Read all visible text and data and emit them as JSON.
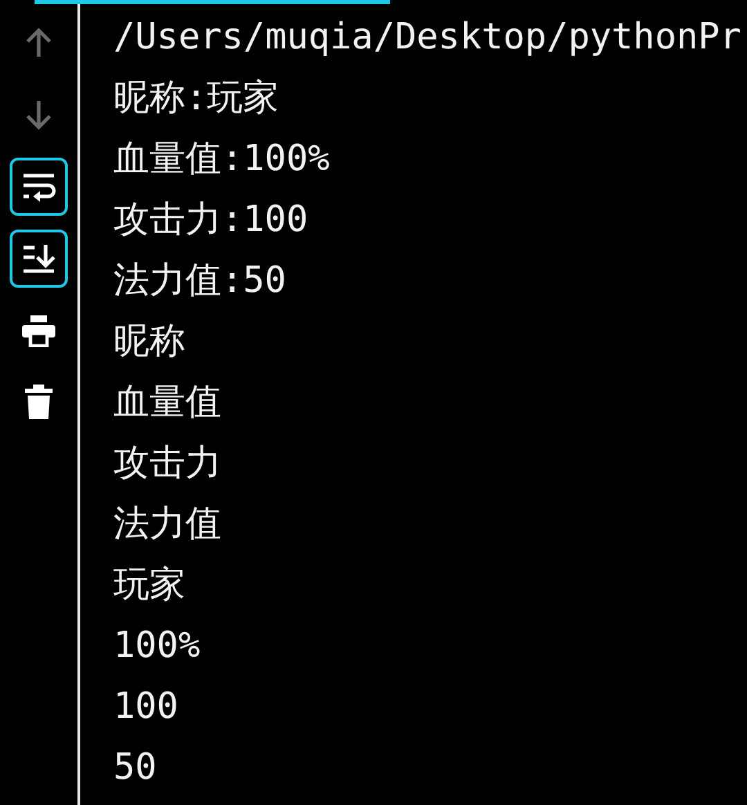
{
  "toolbar": [
    {
      "kind": "up",
      "disabled": true,
      "selected": false
    },
    {
      "kind": "down",
      "disabled": true,
      "selected": false
    },
    {
      "kind": "wrap",
      "disabled": false,
      "selected": true
    },
    {
      "kind": "scroll",
      "disabled": false,
      "selected": true
    },
    {
      "kind": "print",
      "disabled": false,
      "selected": false
    },
    {
      "kind": "trash",
      "disabled": false,
      "selected": false
    }
  ],
  "console": {
    "lines": [
      "/Users/muqia/Desktop/pythonPr",
      "昵称:玩家",
      "血量值:100%",
      "攻击力:100",
      "法力值:50",
      "昵称",
      "血量值",
      "攻击力",
      "法力值",
      "玩家",
      "100%",
      "100",
      "50"
    ]
  }
}
